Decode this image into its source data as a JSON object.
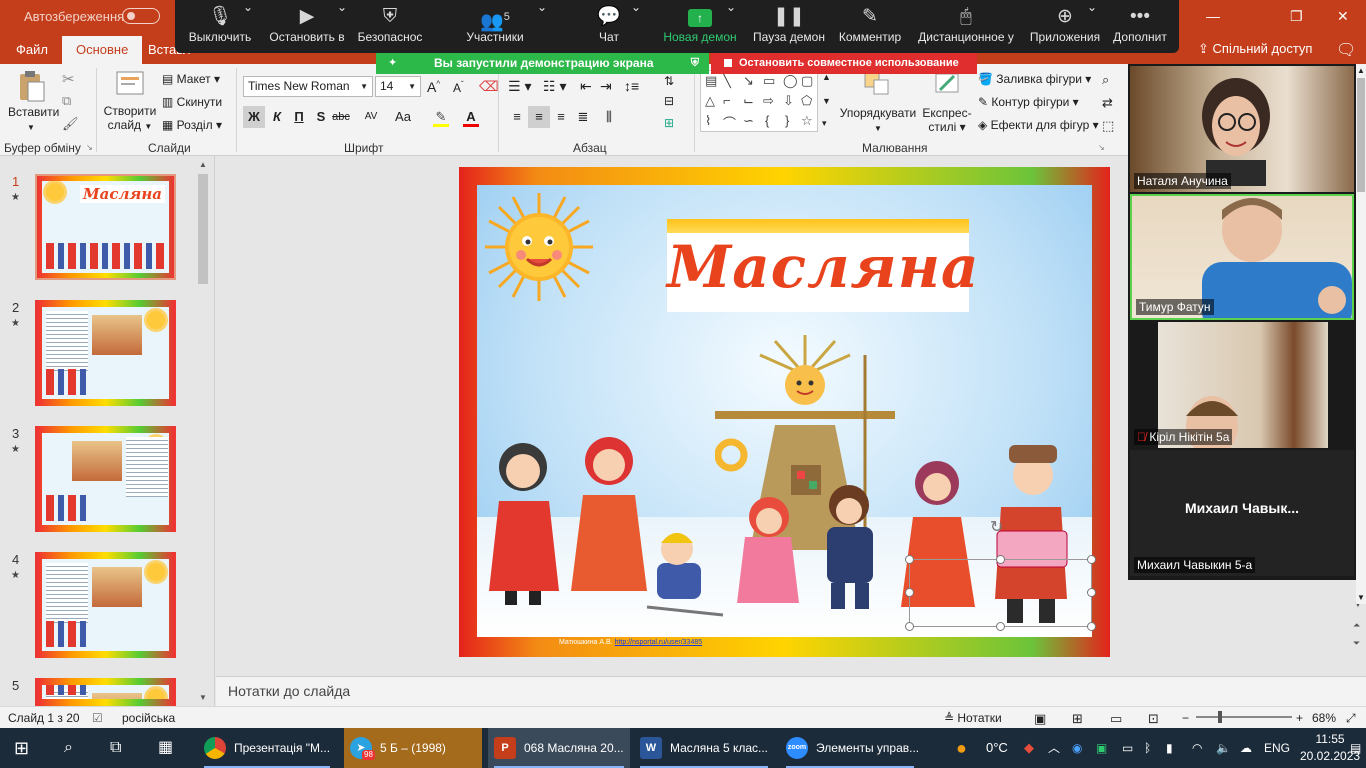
{
  "titlebar": {
    "autosave_label": "Автозбереження",
    "min_icon": "minimize-icon",
    "max_icon": "restore-icon",
    "close_icon": "close-icon"
  },
  "ribbon_tabs": {
    "file": "Файл",
    "home": "Основне",
    "insert": "Вставл",
    "share": "Спільний доступ"
  },
  "zoom_toolbar": {
    "mute": "Выключить",
    "stop_video": "Остановить в",
    "security": "Безопаснос",
    "participants": "Участники",
    "participants_count": "5",
    "chat": "Чат",
    "new_share": "Новая демон",
    "pause_share": "Пауза демон",
    "annotate": "Комментир",
    "remote_control": "Дистанционное у",
    "apps": "Приложения",
    "more": "Дополнит"
  },
  "share_banner": {
    "sharing_notice": "Вы запустили демонстрацию экрана",
    "stop_share": "Остановить совместное использование"
  },
  "ribbon": {
    "paste": "Вставити",
    "clipboard_label": "Буфер обміну",
    "new_slide_line1": "Створити",
    "new_slide_line2": "слайд",
    "layout": "Макет",
    "reset": "Скинути",
    "section": "Розділ",
    "slides_label": "Слайди",
    "font_name": "Times New Roman",
    "font_size": "14",
    "font_label": "Шрифт",
    "bold": "Ж",
    "italic": "К",
    "underline": "П",
    "strike": "S",
    "shadow": "abc",
    "spacing": "AV",
    "case": "Аа",
    "paragraph_label": "Абзац",
    "arrange": "Упорядкувати",
    "quick_styles_line1": "Експрес-",
    "quick_styles_line2": "стилі",
    "shape_fill": "Заливка фігури",
    "shape_outline": "Контур фігури",
    "shape_effects": "Ефекти для фігур",
    "drawing_label": "Малювання"
  },
  "slides": [
    {
      "num": "1",
      "title": "Масляна"
    },
    {
      "num": "2"
    },
    {
      "num": "3"
    },
    {
      "num": "4"
    },
    {
      "num": "5"
    }
  ],
  "slide": {
    "title": "Масляна",
    "credit_author": "Матюшкина А.В.",
    "credit_link": "http://nsportal.ru/user/33485"
  },
  "notes_placeholder": "Нотатки до слайда",
  "status": {
    "slide_pos": "Слайд 1 з 20",
    "language": "російська",
    "notes": "Нотатки",
    "zoom": "68%"
  },
  "gallery": [
    {
      "name": "Наталя Анучина"
    },
    {
      "name": "Тимур Фатун"
    },
    {
      "name": "Кірiл Нікітін 5а"
    },
    {
      "big": "Михаил  Чавык...",
      "name": "Михаил Чавыкин 5-а"
    }
  ],
  "taskbar": {
    "app1": "Презентація \"М...",
    "app2": "5 Б – (1998)",
    "app2_badge": "98",
    "app3": "068 Масляна 20...",
    "app4": "Масляна 5 клас...",
    "app5": "Элементы управ...",
    "temp": "0°C",
    "lang": "ENG",
    "time": "11:55",
    "date": "20.02.2023"
  },
  "colors": {
    "ppt_accent": "#c43e1c",
    "zoom_bar": "#1f1f1f",
    "banner_green": "#2db84a",
    "banner_red": "#e02d2d"
  }
}
